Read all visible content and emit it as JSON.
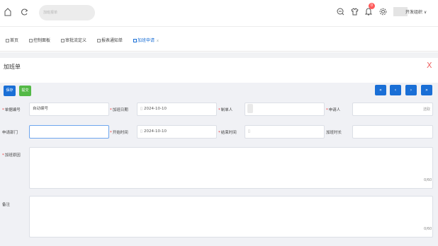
{
  "header": {
    "search_placeholder": "加班报单",
    "notification_count": "0",
    "org_switch": "开发组织 ∨"
  },
  "tabs": [
    {
      "label": "首页"
    },
    {
      "label": "控制面板"
    },
    {
      "label": "审批流定义"
    },
    {
      "label": "报表通知单"
    },
    {
      "label": "加班申请"
    }
  ],
  "form": {
    "title": "加班单",
    "close": "X",
    "toolbar": {
      "save": "保存",
      "submit": "提交"
    },
    "nav": {
      "first": "«",
      "prev": "‹",
      "next": "›",
      "last": "»"
    },
    "labels": {
      "doc_no": "单据编号",
      "overtime_date": "加班日期",
      "creator": "制单人",
      "applicant": "申请人",
      "dept": "申请部门",
      "start_time": "开始时间",
      "end_time": "结束时间",
      "duration": "加班时长",
      "reason": "加班原因",
      "remark": "备注"
    },
    "values": {
      "doc_no": "自动编号",
      "overtime_date": "2024-10-10",
      "start_time": "2024-10-10",
      "end_time": "",
      "dept": "",
      "applicant": "",
      "duration": ""
    },
    "choose_label": "选取",
    "reason_counter": "0/60",
    "remark_counter": "0/60"
  },
  "colors": {
    "primary": "#1a6fd6",
    "success": "#54b947",
    "required": "#e33333",
    "close": "#e66666"
  }
}
